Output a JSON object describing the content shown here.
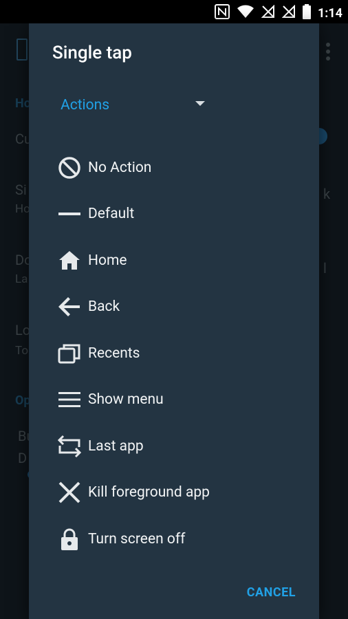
{
  "status_bar": {
    "time": "1:14",
    "icons": [
      "nfc-icon",
      "wifi-icon",
      "no-sim-icon",
      "no-sim-icon",
      "battery-icon"
    ]
  },
  "background": {
    "section1": "Ho",
    "row1": "Cu",
    "row2_title": "Si",
    "row2_sub": "Ho",
    "row3_title": "Do",
    "row3_sub": "La",
    "row4_title": "Lo",
    "row4_sub": "To",
    "section2": "Op",
    "row5_title": "Bu",
    "row5_sub": "D",
    "trail1": "k",
    "trail2": "l"
  },
  "dialog": {
    "title": "Single tap",
    "spinner_value": "Actions",
    "items": [
      {
        "label": "No Action",
        "icon": "block-icon"
      },
      {
        "label": "Default",
        "icon": "minus-icon"
      },
      {
        "label": "Home",
        "icon": "home-icon"
      },
      {
        "label": "Back",
        "icon": "back-arrow-icon"
      },
      {
        "label": "Recents",
        "icon": "recents-icon"
      },
      {
        "label": "Show menu",
        "icon": "menu-icon"
      },
      {
        "label": "Last app",
        "icon": "last-app-icon"
      },
      {
        "label": "Kill foreground app",
        "icon": "close-icon"
      },
      {
        "label": "Turn screen off",
        "icon": "lock-icon"
      }
    ],
    "cancel_label": "CANCEL"
  },
  "colors": {
    "accent": "#21a1e6",
    "dialog_bg": "#233442",
    "text": "#f2f4f5"
  }
}
